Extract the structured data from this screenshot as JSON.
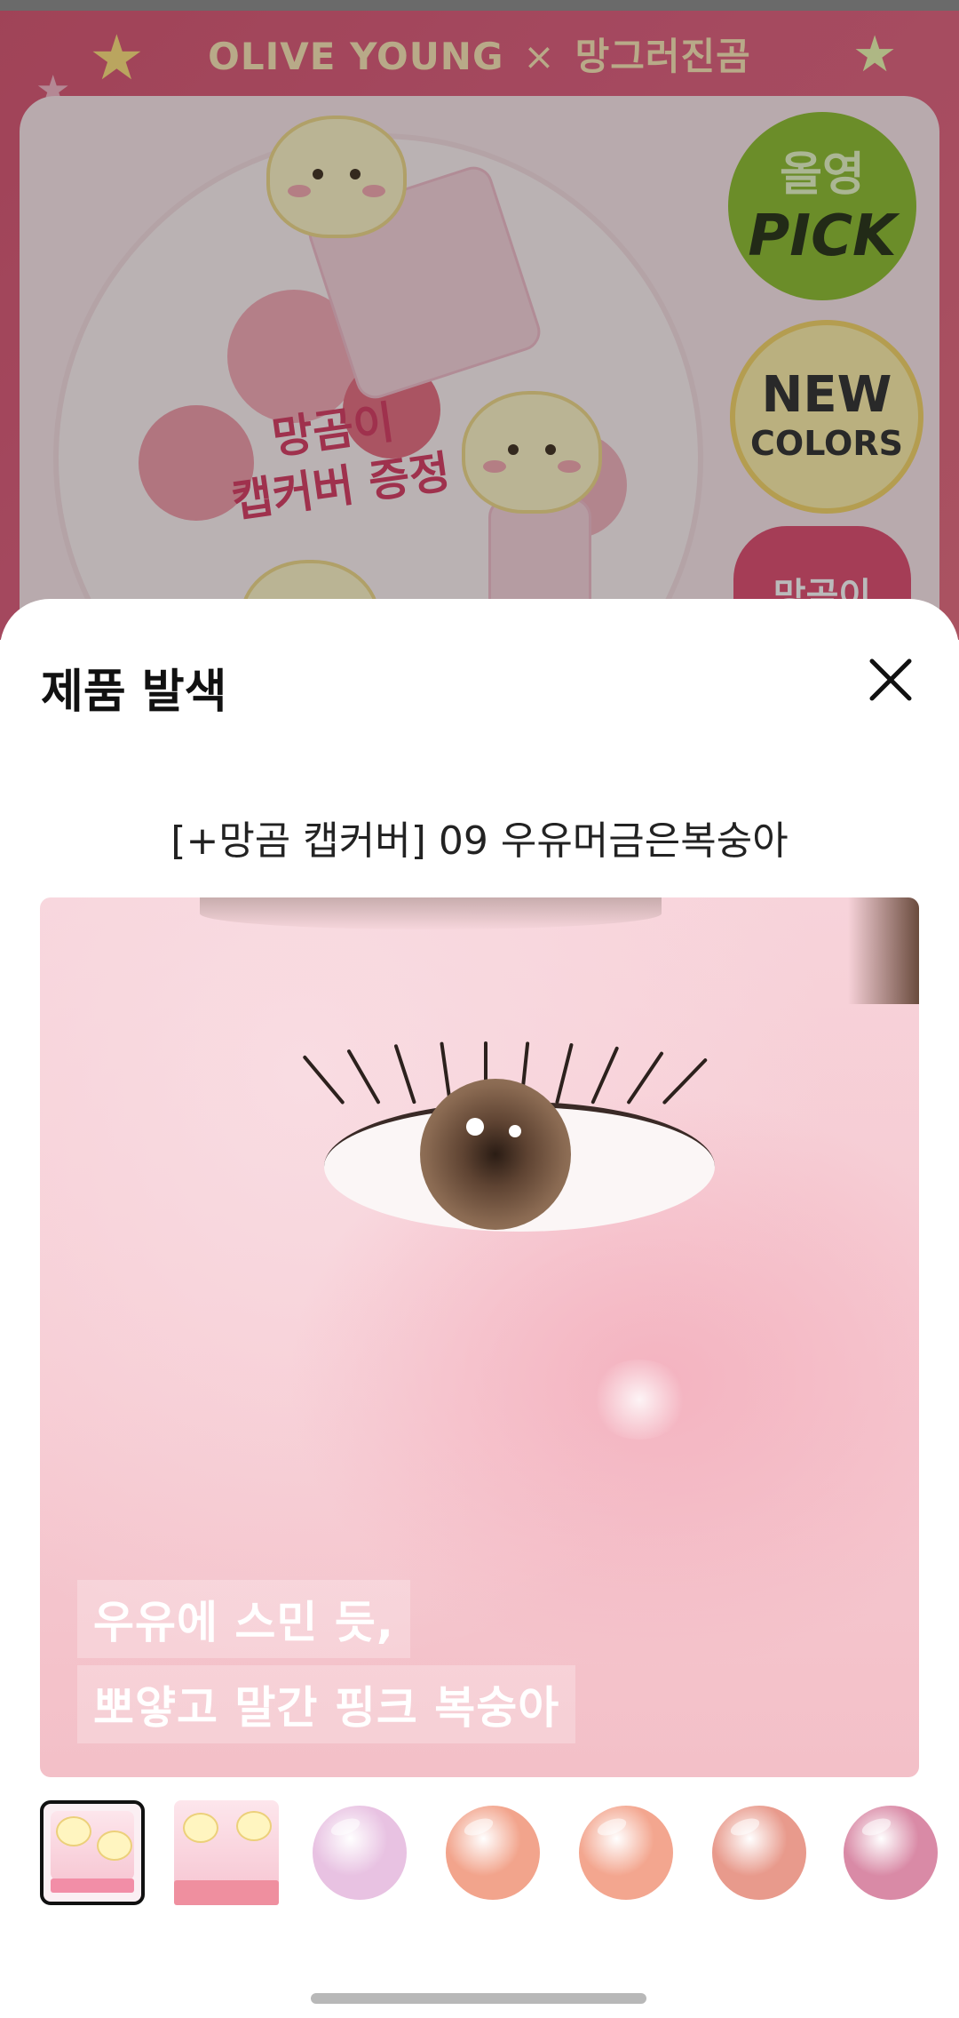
{
  "banner": {
    "brand_left": "OLIVE YOUNG",
    "brand_sep": "×",
    "brand_right": "망그러진곰",
    "gift_line1": "망곰이",
    "gift_line2": "캡커버 증정",
    "pick_badge": {
      "line1": "올영",
      "line2": "PICK"
    },
    "new_badge": {
      "line1": "NEW",
      "line2": "COLORS"
    },
    "bear_badge": "망곰이"
  },
  "sheet": {
    "title": "제품 발색",
    "close_icon": "close-icon",
    "product_name": "[+망곰 캡커버] 09 우유머금은복숭아",
    "caption_line1": "우유에 스민 듯,",
    "caption_line2": "뽀얗고 말간 핑크 복숭아",
    "thumbnails": [
      {
        "type": "package",
        "selected": true
      },
      {
        "type": "package",
        "selected": false
      },
      {
        "type": "swatch",
        "color": "#e8c2e2"
      },
      {
        "type": "swatch",
        "color": "#f2a48c"
      },
      {
        "type": "swatch",
        "color": "#f3a68f"
      },
      {
        "type": "swatch",
        "color": "#e89a8c"
      },
      {
        "type": "swatch",
        "color": "#d98aa6"
      }
    ]
  },
  "colors": {
    "banner_bg": "#d9506e",
    "sheet_bg": "#ffffff",
    "title_text": "#111111"
  }
}
